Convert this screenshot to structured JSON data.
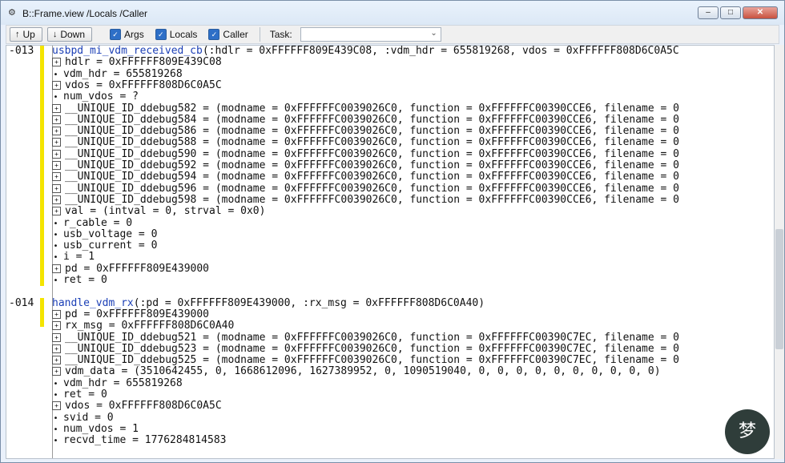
{
  "window": {
    "title": "B::Frame.view /Locals /Caller"
  },
  "toolbar": {
    "up_label": "Up",
    "down_label": "Down",
    "args_label": "Args",
    "locals_label": "Locals",
    "caller_label": "Caller",
    "task_label": "Task:",
    "task_value": ""
  },
  "frames": [
    {
      "level": "-013",
      "func": "usbpd_mi_vdm_received_cb",
      "args": "(:hdlr = 0xFFFFFF809E439C08, :vdm_hdr = 655819268, vdos = 0xFFFFFF808D6C0A5C",
      "vars": [
        {
          "sigil": "plus",
          "text": "hdlr = 0xFFFFFF809E439C08"
        },
        {
          "sigil": "dot",
          "text": "vdm_hdr = 655819268"
        },
        {
          "sigil": "plus",
          "text": "vdos = 0xFFFFFF808D6C0A5C"
        },
        {
          "sigil": "dot",
          "text": "num_vdos = ?"
        },
        {
          "sigil": "plus",
          "text": "__UNIQUE_ID_ddebug582 = (modname = 0xFFFFFFC0039026C0, function = 0xFFFFFFC00390CCE6, filename = 0"
        },
        {
          "sigil": "plus",
          "text": "__UNIQUE_ID_ddebug584 = (modname = 0xFFFFFFC0039026C0, function = 0xFFFFFFC00390CCE6, filename = 0"
        },
        {
          "sigil": "plus",
          "text": "__UNIQUE_ID_ddebug586 = (modname = 0xFFFFFFC0039026C0, function = 0xFFFFFFC00390CCE6, filename = 0"
        },
        {
          "sigil": "plus",
          "text": "__UNIQUE_ID_ddebug588 = (modname = 0xFFFFFFC0039026C0, function = 0xFFFFFFC00390CCE6, filename = 0"
        },
        {
          "sigil": "plus",
          "text": "__UNIQUE_ID_ddebug590 = (modname = 0xFFFFFFC0039026C0, function = 0xFFFFFFC00390CCE6, filename = 0"
        },
        {
          "sigil": "plus",
          "text": "__UNIQUE_ID_ddebug592 = (modname = 0xFFFFFFC0039026C0, function = 0xFFFFFFC00390CCE6, filename = 0"
        },
        {
          "sigil": "plus",
          "text": "__UNIQUE_ID_ddebug594 = (modname = 0xFFFFFFC0039026C0, function = 0xFFFFFFC00390CCE6, filename = 0"
        },
        {
          "sigil": "plus",
          "text": "__UNIQUE_ID_ddebug596 = (modname = 0xFFFFFFC0039026C0, function = 0xFFFFFFC00390CCE6, filename = 0"
        },
        {
          "sigil": "plus",
          "text": "__UNIQUE_ID_ddebug598 = (modname = 0xFFFFFFC0039026C0, function = 0xFFFFFFC00390CCE6, filename = 0"
        },
        {
          "sigil": "plus",
          "text": "val = (intval = 0, strval = 0x0)"
        },
        {
          "sigil": "dot",
          "text": "r_cable = 0"
        },
        {
          "sigil": "dot",
          "text": "usb_voltage = 0"
        },
        {
          "sigil": "dot",
          "text": "usb_current = 0"
        },
        {
          "sigil": "dot",
          "text": "i = 1"
        },
        {
          "sigil": "plus",
          "text": "pd = 0xFFFFFF809E439000"
        },
        {
          "sigil": "dot",
          "text": "ret = 0"
        }
      ]
    },
    {
      "level": "-014",
      "func": "handle_vdm_rx",
      "args": "(:pd = 0xFFFFFF809E439000, :rx_msg = 0xFFFFFF808D6C0A40)",
      "vars": [
        {
          "sigil": "plus",
          "text": "pd = 0xFFFFFF809E439000"
        },
        {
          "sigil": "plus",
          "text": "rx_msg = 0xFFFFFF808D6C0A40"
        },
        {
          "sigil": "plus",
          "text": "__UNIQUE_ID_ddebug521 = (modname = 0xFFFFFFC0039026C0, function = 0xFFFFFFC00390C7EC, filename = 0"
        },
        {
          "sigil": "plus",
          "text": "__UNIQUE_ID_ddebug523 = (modname = 0xFFFFFFC0039026C0, function = 0xFFFFFFC00390C7EC, filename = 0"
        },
        {
          "sigil": "plus",
          "text": "__UNIQUE_ID_ddebug525 = (modname = 0xFFFFFFC0039026C0, function = 0xFFFFFFC00390C7EC, filename = 0"
        },
        {
          "sigil": "plus",
          "text": "vdm_data = (3510642455, 0, 1668612096, 1627389952, 0, 1090519040, 0, 0, 0, 0, 0, 0, 0, 0, 0, 0)"
        },
        {
          "sigil": "dot",
          "text": "vdm_hdr = 655819268"
        },
        {
          "sigil": "dot",
          "text": "ret = 0"
        },
        {
          "sigil": "plus",
          "text": "vdos = 0xFFFFFF808D6C0A5C"
        },
        {
          "sigil": "dot",
          "text": "svid = 0"
        },
        {
          "sigil": "dot",
          "text": "num_vdos = 1"
        },
        {
          "sigil": "dot",
          "text": "recvd_time = 1776284814583"
        }
      ]
    }
  ],
  "icons": {
    "app": "frame-view-icon",
    "up": "up-arrow-icon",
    "down": "down-arrow-icon",
    "expand": "plus-box-icon",
    "leaf": "bullet-icon"
  },
  "colors": {
    "function_name": "#1b3fb6",
    "frame_marker": "#f4e400",
    "checkbox": "#2e6fc7"
  }
}
